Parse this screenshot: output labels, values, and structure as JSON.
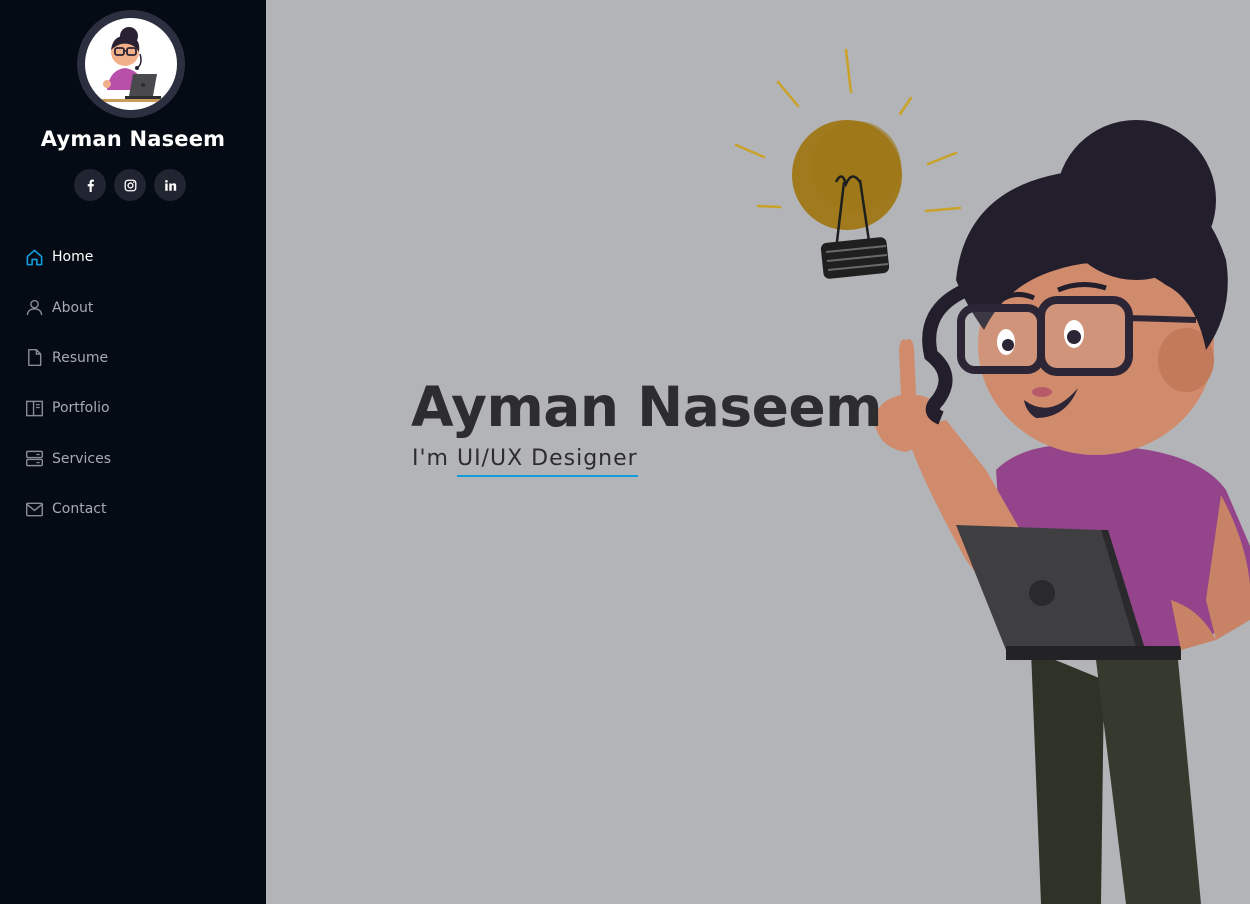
{
  "profile": {
    "name": "Ayman Naseem"
  },
  "social": [
    {
      "icon": "facebook-icon"
    },
    {
      "icon": "instagram-icon"
    },
    {
      "icon": "linkedin-icon"
    }
  ],
  "nav": {
    "items": [
      {
        "label": "Home",
        "icon": "home-icon",
        "active": true
      },
      {
        "label": "About",
        "icon": "person-icon",
        "active": false
      },
      {
        "label": "Resume",
        "icon": "file-icon",
        "active": false
      },
      {
        "label": "Portfolio",
        "icon": "book-icon",
        "active": false
      },
      {
        "label": "Services",
        "icon": "server-icon",
        "active": false
      },
      {
        "label": "Contact",
        "icon": "envelope-icon",
        "active": false
      }
    ]
  },
  "hero": {
    "title": "Ayman Naseem",
    "prefix": "I'm ",
    "role": "UI/UX Designer"
  },
  "colors": {
    "accent": "#149ddd",
    "sidebar_bg": "#040b14",
    "hero_bg": "#b3b4b7"
  }
}
